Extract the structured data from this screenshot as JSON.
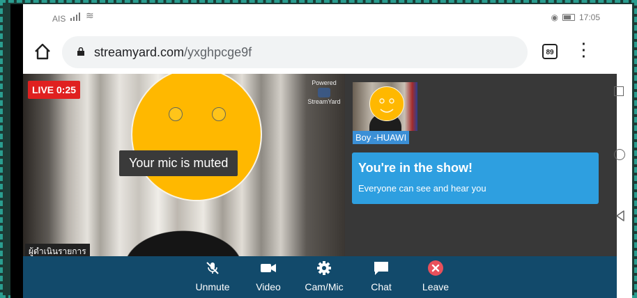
{
  "status_bar": {
    "carrier": "AIS",
    "time": "17:05"
  },
  "browser": {
    "url_domain": "streamyard.com",
    "url_path": "/yxghpcge9f",
    "tab_count": "89"
  },
  "stage": {
    "live_badge": "LIVE 0:25",
    "powered_by_line1": "Powered",
    "powered_by_line2": "StreamYard",
    "mic_muted_toast": "Your mic is muted",
    "host_name": "ผู้ดำเนินรายการ",
    "guest_name": "Boy -HUAWI"
  },
  "show_notice": {
    "title": "You're in the show!",
    "subtitle": "Everyone can see and hear you"
  },
  "controls": [
    {
      "label": "Unmute",
      "icon": "mic-off-icon"
    },
    {
      "label": "Video",
      "icon": "camera-icon"
    },
    {
      "label": "Cam/Mic",
      "icon": "gear-icon"
    },
    {
      "label": "Chat",
      "icon": "chat-icon"
    },
    {
      "label": "Leave",
      "icon": "close-circle-icon"
    }
  ],
  "colors": {
    "live": "#e02020",
    "notice": "#2e9fe0",
    "controls_bg": "#124a6b",
    "leave": "#e8505b",
    "avatar": "#ffb800"
  }
}
